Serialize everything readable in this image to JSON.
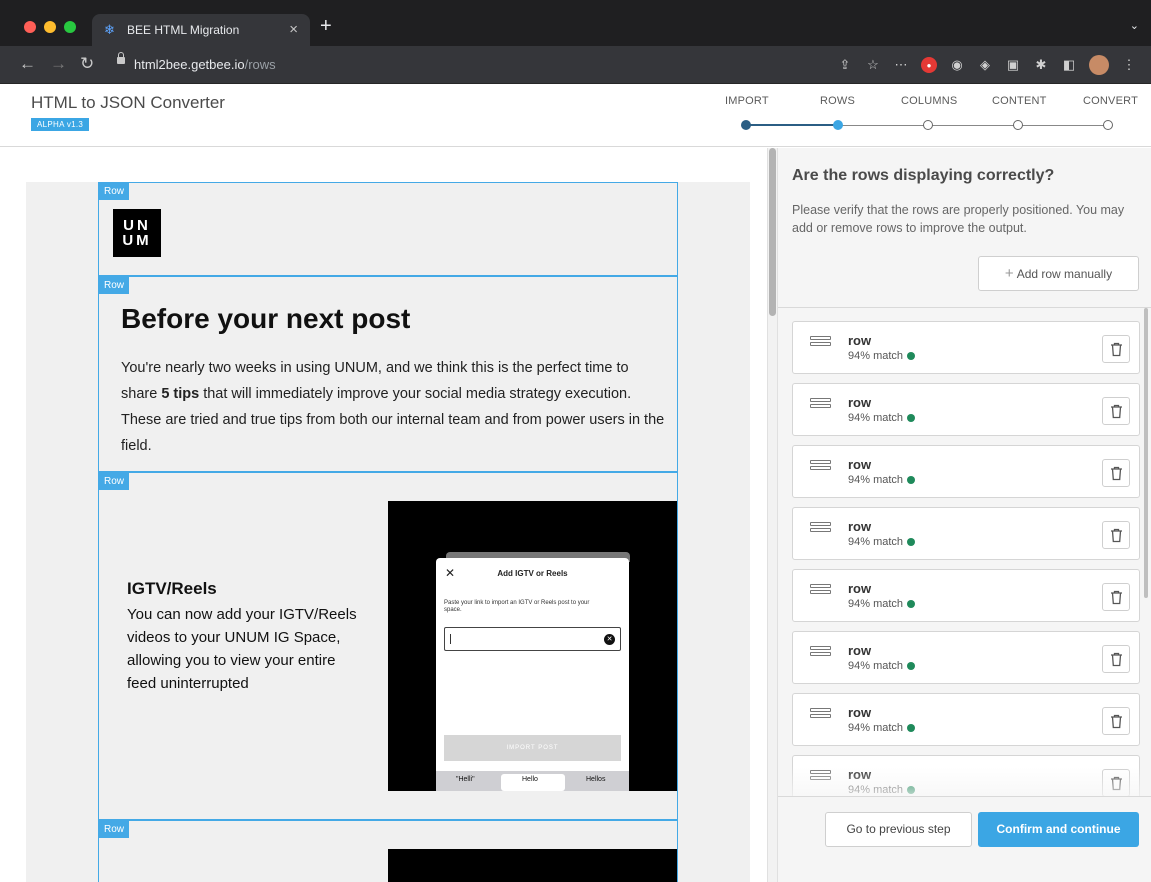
{
  "browser": {
    "tab_title": "BEE HTML Migration",
    "url_host": "html2bee.getbee.io",
    "url_path": "/rows"
  },
  "app": {
    "title": "HTML to JSON Converter",
    "version_badge": "ALPHA v1.3",
    "steps": [
      {
        "label": "IMPORT",
        "state": "done"
      },
      {
        "label": "ROWS",
        "state": "active"
      },
      {
        "label": "COLUMNS",
        "state": "todo"
      },
      {
        "label": "CONTENT",
        "state": "todo"
      },
      {
        "label": "CONVERT",
        "state": "todo"
      }
    ],
    "step_colors": {
      "done": "#2b5e84",
      "active": "#3ba6e4"
    }
  },
  "preview": {
    "row_tag": "Row",
    "logo_line1": "UN",
    "logo_line2": "UM",
    "post_title": "Before your next post",
    "post_body_pre": "You're nearly two weeks in using UNUM, and we think this is the perfect time to share ",
    "post_body_bold": "5 tips",
    "post_body_post": " that will immediately improve your social media strategy execution. These are tried and true tips from both our internal team and from power users in the field.",
    "igtv_title": "IGTV/Reels",
    "igtv_body": "You can now add your IGTV/Reels videos to your UNUM IG Space, allowing you to view your entire feed uninterrupted",
    "modal": {
      "title": "Add IGTV or Reels",
      "description": "Paste your link to import an IGTV or Reels post to your space.",
      "button": "IMPORT POST",
      "suggestions": [
        "\"Helli\"",
        "Hello",
        "Hellos"
      ]
    }
  },
  "panel": {
    "question": "Are the rows displaying correctly?",
    "description": "Please verify that the rows are properly positioned. You may add or remove rows to improve the output.",
    "add_row_label": "Add row manually",
    "rows": [
      {
        "name": "row",
        "match": "94% match"
      },
      {
        "name": "row",
        "match": "94% match"
      },
      {
        "name": "row",
        "match": "94% match"
      },
      {
        "name": "row",
        "match": "94% match"
      },
      {
        "name": "row",
        "match": "94% match"
      },
      {
        "name": "row",
        "match": "94% match"
      },
      {
        "name": "row",
        "match": "94% match"
      },
      {
        "name": "row",
        "match": "94% match"
      }
    ],
    "match_color": "#1f8a5b",
    "prev_label": "Go to previous step",
    "next_label": "Confirm and continue",
    "accent": "#3ba6e4"
  }
}
